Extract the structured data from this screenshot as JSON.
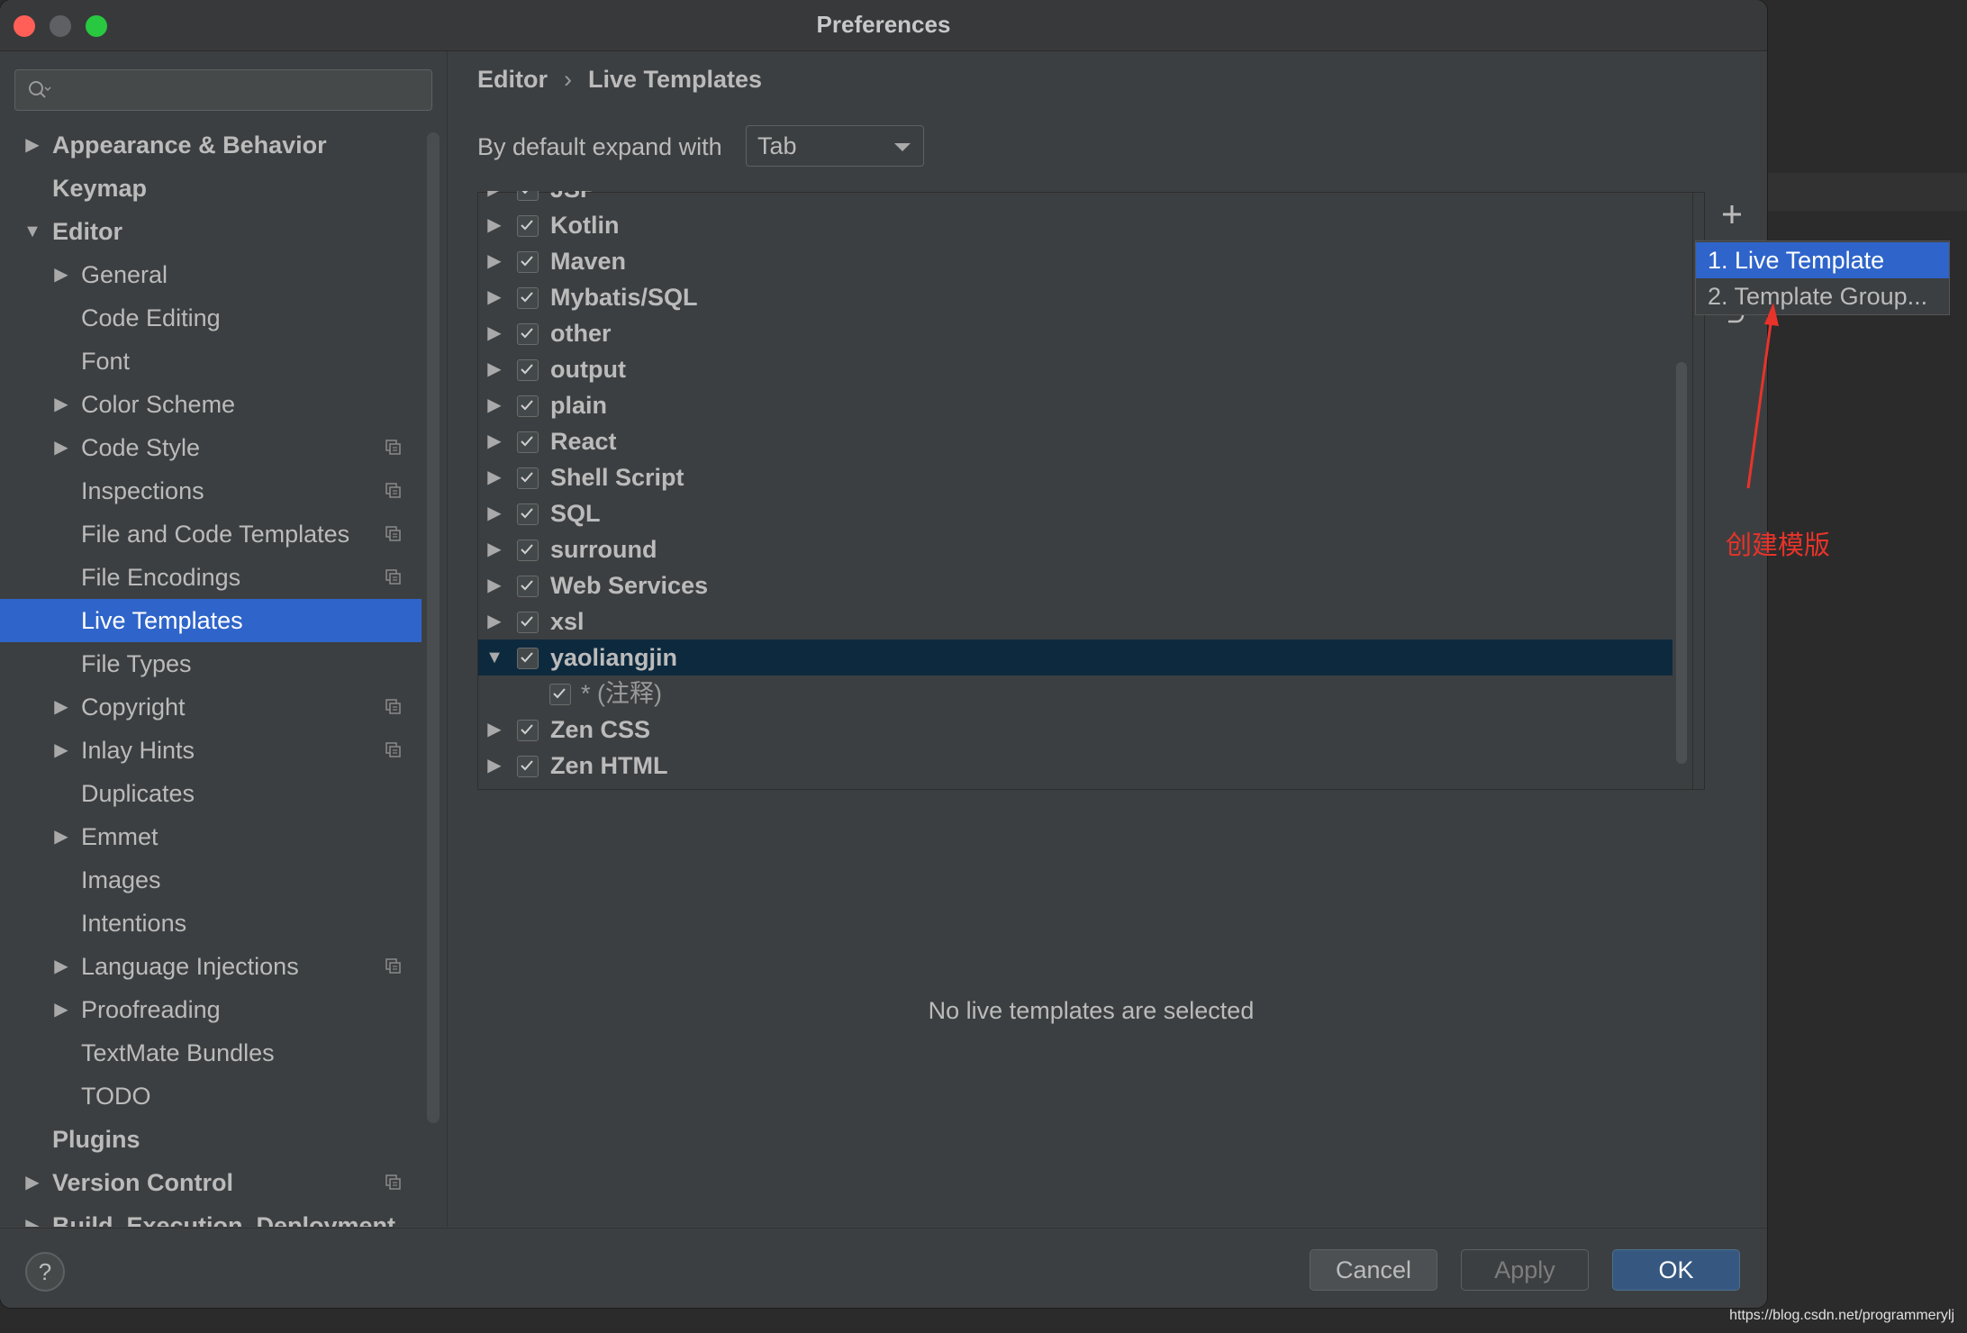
{
  "window": {
    "title": "Preferences"
  },
  "search": {
    "placeholder": ""
  },
  "sidebar": {
    "items": [
      {
        "label": "Appearance & Behavior",
        "level": 0,
        "arrow": "right",
        "bold": true
      },
      {
        "label": "Keymap",
        "level": 0,
        "arrow": "",
        "bold": true
      },
      {
        "label": "Editor",
        "level": 0,
        "arrow": "down",
        "bold": true
      },
      {
        "label": "General",
        "level": 1,
        "arrow": "right"
      },
      {
        "label": "Code Editing",
        "level": 1,
        "arrow": ""
      },
      {
        "label": "Font",
        "level": 1,
        "arrow": ""
      },
      {
        "label": "Color Scheme",
        "level": 1,
        "arrow": "right"
      },
      {
        "label": "Code Style",
        "level": 1,
        "arrow": "right",
        "badge": true
      },
      {
        "label": "Inspections",
        "level": 1,
        "arrow": "",
        "badge": true
      },
      {
        "label": "File and Code Templates",
        "level": 1,
        "arrow": "",
        "badge": true
      },
      {
        "label": "File Encodings",
        "level": 1,
        "arrow": "",
        "badge": true
      },
      {
        "label": "Live Templates",
        "level": 1,
        "arrow": "",
        "selected": true
      },
      {
        "label": "File Types",
        "level": 1,
        "arrow": ""
      },
      {
        "label": "Copyright",
        "level": 1,
        "arrow": "right",
        "badge": true
      },
      {
        "label": "Inlay Hints",
        "level": 1,
        "arrow": "right",
        "badge": true
      },
      {
        "label": "Duplicates",
        "level": 1,
        "arrow": ""
      },
      {
        "label": "Emmet",
        "level": 1,
        "arrow": "right"
      },
      {
        "label": "Images",
        "level": 1,
        "arrow": ""
      },
      {
        "label": "Intentions",
        "level": 1,
        "arrow": ""
      },
      {
        "label": "Language Injections",
        "level": 1,
        "arrow": "right",
        "badge": true
      },
      {
        "label": "Proofreading",
        "level": 1,
        "arrow": "right"
      },
      {
        "label": "TextMate Bundles",
        "level": 1,
        "arrow": ""
      },
      {
        "label": "TODO",
        "level": 1,
        "arrow": ""
      },
      {
        "label": "Plugins",
        "level": 0,
        "arrow": "",
        "bold": true
      },
      {
        "label": "Version Control",
        "level": 0,
        "arrow": "right",
        "bold": true,
        "badge": true
      },
      {
        "label": "Build, Execution, Deployment",
        "level": 0,
        "arrow": "right",
        "bold": true
      }
    ]
  },
  "breadcrumb": {
    "parent": "Editor",
    "separator": "›",
    "current": "Live Templates"
  },
  "expand": {
    "label": "By default expand with",
    "value": "Tab"
  },
  "templates": {
    "groups": [
      {
        "label": "JSP",
        "arrow": "right",
        "checked": true
      },
      {
        "label": "Kotlin",
        "arrow": "right",
        "checked": true
      },
      {
        "label": "Maven",
        "arrow": "right",
        "checked": true
      },
      {
        "label": "Mybatis/SQL",
        "arrow": "right",
        "checked": true
      },
      {
        "label": "other",
        "arrow": "right",
        "checked": true
      },
      {
        "label": "output",
        "arrow": "right",
        "checked": true
      },
      {
        "label": "plain",
        "arrow": "right",
        "checked": true
      },
      {
        "label": "React",
        "arrow": "right",
        "checked": true
      },
      {
        "label": "Shell Script",
        "arrow": "right",
        "checked": true
      },
      {
        "label": "SQL",
        "arrow": "right",
        "checked": true
      },
      {
        "label": "surround",
        "arrow": "right",
        "checked": true
      },
      {
        "label": "Web Services",
        "arrow": "right",
        "checked": true
      },
      {
        "label": "xsl",
        "arrow": "right",
        "checked": true
      },
      {
        "label": "yaoliangjin",
        "arrow": "down",
        "checked": true,
        "selected": true
      },
      {
        "label": "* (注释)",
        "arrow": "",
        "checked": true,
        "child": true
      },
      {
        "label": "Zen CSS",
        "arrow": "right",
        "checked": true
      },
      {
        "label": "Zen HTML",
        "arrow": "right",
        "checked": true
      }
    ],
    "empty_message": "No live templates are selected"
  },
  "popup": {
    "items": [
      {
        "label": "1. Live Template",
        "active": true
      },
      {
        "label": "2. Template Group...",
        "active": false
      }
    ]
  },
  "annotation": {
    "text": "创建模版",
    "color": "#e8332a"
  },
  "footer": {
    "help": "?",
    "cancel": "Cancel",
    "apply": "Apply",
    "ok": "OK"
  },
  "watermark": "https://blog.csdn.net/programmerylj",
  "colors": {
    "selection": "#2f65ca",
    "tree_selection": "#0d293e",
    "ok_button": "#365880",
    "window_bg": "#3c3f41"
  },
  "icons": {
    "search": "search-icon",
    "add": "plus-icon",
    "restore": "undo-icon",
    "badge": "project-scope-icon",
    "checkbox": "check-icon"
  }
}
